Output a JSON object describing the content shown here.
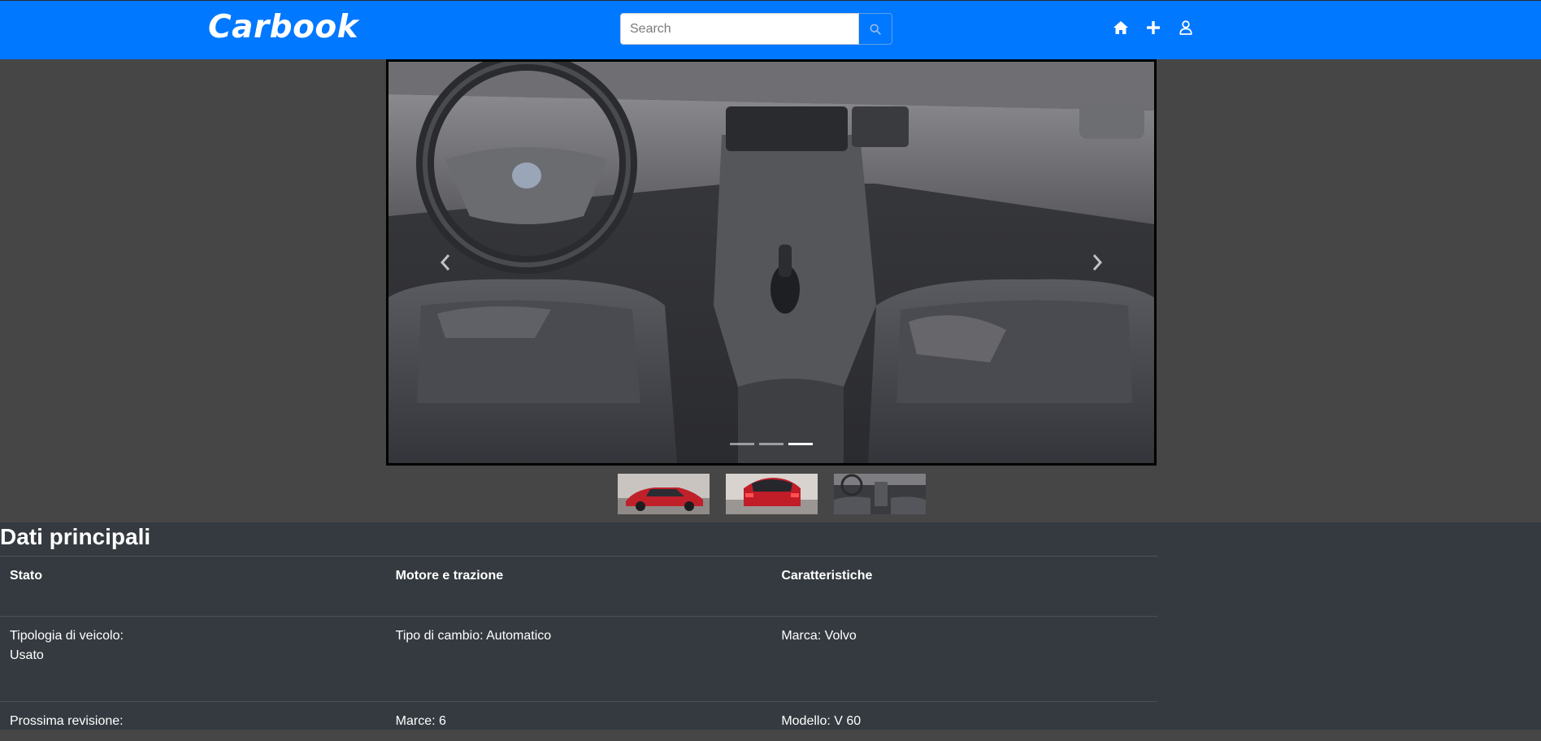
{
  "navbar": {
    "brand": "Carbook",
    "search_placeholder": "Search",
    "search_icon": "search-icon",
    "icons": [
      "home-icon",
      "plus-icon",
      "user-icon"
    ],
    "background_color": "#0078ff"
  },
  "carousel": {
    "active_index": 2,
    "slide_count": 3,
    "prev_icon": "chevron-left-icon",
    "next_icon": "chevron-right-icon"
  },
  "thumbnails": [
    {
      "name": "red-car-front"
    },
    {
      "name": "red-car-rear"
    },
    {
      "name": "car-interior"
    }
  ],
  "details": {
    "title": "Dati principali",
    "headers": [
      "Stato",
      "Motore e trazione",
      "Caratteristiche"
    ],
    "rows": [
      [
        "Tipologia di veicolo:\nUsato",
        "Tipo di cambio: Automatico",
        "Marca: Volvo"
      ],
      [
        "Prossima revisione:",
        "Marce: 6",
        "Modello: V 60"
      ]
    ]
  }
}
